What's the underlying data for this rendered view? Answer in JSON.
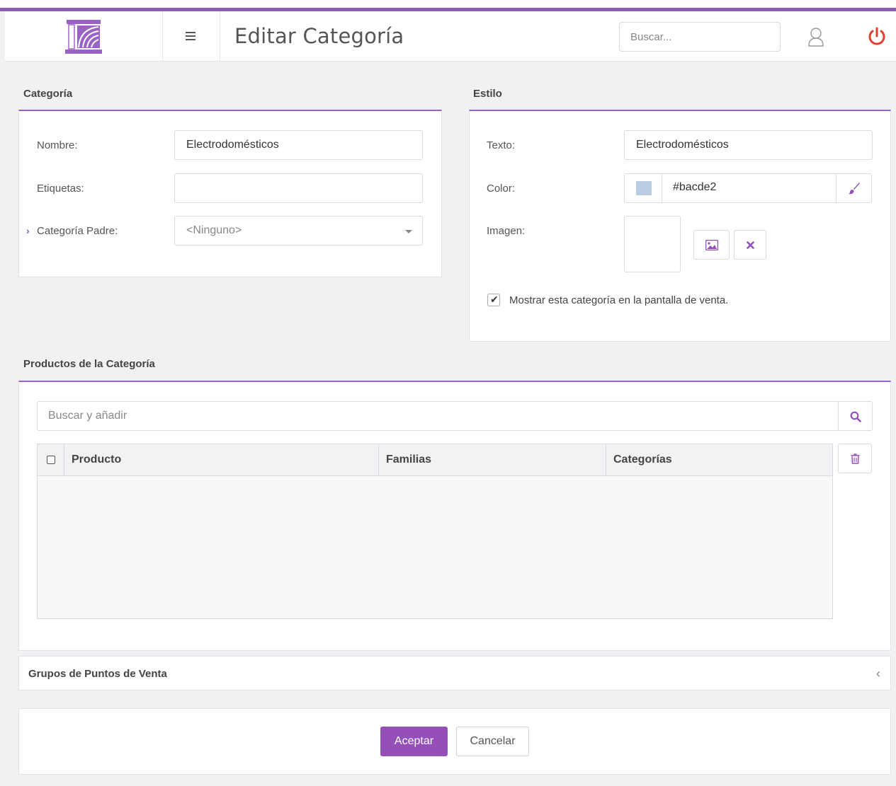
{
  "header": {
    "title": "Editar Categoría",
    "search_placeholder": "Buscar..."
  },
  "categoria": {
    "section_title": "Categoría",
    "nombre_label": "Nombre:",
    "nombre_value": "Electrodomésticos",
    "etiquetas_label": "Etiquetas:",
    "etiquetas_value": "",
    "padre_label": "Categoría Padre:",
    "padre_value": "<Ninguno>"
  },
  "estilo": {
    "section_title": "Estilo",
    "texto_label": "Texto:",
    "texto_value": "Electrodomésticos",
    "color_label": "Color:",
    "color_value": "#bacde2",
    "imagen_label": "Imagen:",
    "mostrar_label": "Mostrar esta categoría en la pantalla de venta.",
    "mostrar_checked": true
  },
  "productos": {
    "section_title": "Productos de la Categoría",
    "search_placeholder": "Buscar y añadir",
    "columns": [
      "Producto",
      "Familias",
      "Categorías"
    ],
    "rows": []
  },
  "grupos": {
    "label": "Grupos de Puntos de Venta"
  },
  "actions": {
    "accept": "Aceptar",
    "cancel": "Cancelar"
  },
  "colors": {
    "accent": "#9450b8",
    "power": "#e0412e"
  }
}
